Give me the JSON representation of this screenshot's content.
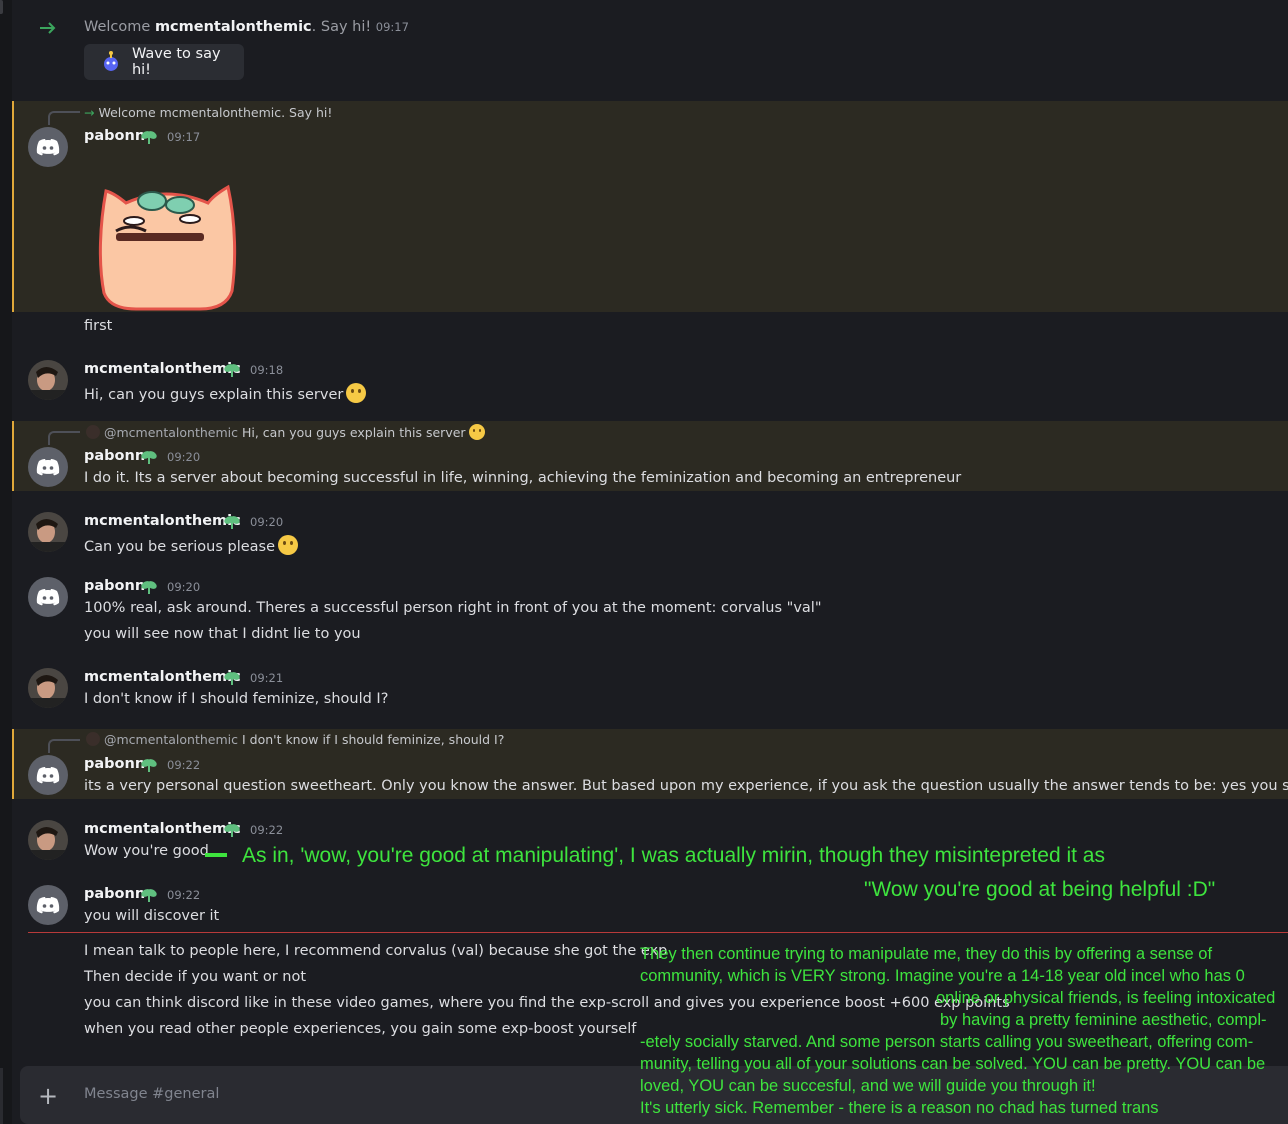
{
  "join": {
    "text_prefix": "Welcome",
    "username": "mcmentalonthemic",
    "text_suffix": ". Say hi!",
    "time": "09:17",
    "wave_button": "Wave to say hi!"
  },
  "messages": [
    {
      "reply_text": "Welcome mcmentalonthemic. Say hi!",
      "author": "pabonn",
      "time": "09:17",
      "sticker": "peach-face-sticker",
      "lines": [
        "first"
      ]
    },
    {
      "author": "mcmentalonthemic",
      "time": "09:18",
      "lines": [
        "Hi, can you guys explain this server"
      ]
    },
    {
      "reply_mention": "@mcmentalonthemic",
      "reply_text": "Hi, can you guys explain this server",
      "author": "pabonn",
      "time": "09:20",
      "lines": [
        "I do it. Its a server about becoming successful in life, winning, achieving the feminization and becoming an entrepreneur"
      ]
    },
    {
      "author": "mcmentalonthemic",
      "time": "09:20",
      "lines": [
        "Can you be serious please"
      ]
    },
    {
      "author": "pabonn",
      "time": "09:20",
      "lines": [
        "100% real, ask around. Theres a successful person right in front of you at the moment: corvalus \"val\"",
        "you will see now that I didnt lie to you"
      ]
    },
    {
      "author": "mcmentalonthemic",
      "time": "09:21",
      "lines": [
        "I don't know if I should feminize, should I?"
      ]
    },
    {
      "reply_mention": "@mcmentalonthemic",
      "reply_text": "I don't know if I should feminize, should I?",
      "author": "pabonn",
      "time": "09:22",
      "lines": [
        "its a very personal question sweetheart. Only you know the answer. But based upon my experience, if you ask the question usually the answer tends to be: yes you should"
      ]
    },
    {
      "author": "mcmentalonthemic",
      "time": "09:22",
      "lines": [
        "Wow you're good"
      ]
    },
    {
      "author": "pabonn",
      "time": "09:22",
      "lines": [
        "you will discover it",
        "I mean talk to people here, I recommend corvalus (val) because she got the exp",
        "Then decide if you want or not",
        "you can think discord like in these video games, where you find the exp-scroll and gives you experience boost +600 exp points",
        "when you read other people experiences, you gain some exp-boost yourself"
      ]
    }
  ],
  "annotations": {
    "note1_line1": "As in, 'wow, you're good at manipulating', I was actually mirin, though they misintepreted it as",
    "note1_line2": "\"Wow you're good at being helpful :D\"",
    "note2": [
      "They then continue trying to manipulate me, they do this by offering a sense of",
      "community, which is VERY strong. Imagine you're a 14-18 year old incel who has 0",
      "online or physical friends, is feeling intoxicated",
      "by having a pretty feminine aesthetic, compl-",
      "-etely socially starved. And some person starts calling you sweetheart, offering com-",
      "munity, telling you all of your solutions can be solved. YOU can be pretty. YOU can be",
      "loved, YOU can be succesful, and we will guide you through it!",
      "It's utterly sick. Remember - there is a reason no chad has turned trans"
    ],
    "color": "#3ee43e"
  },
  "composer": {
    "placeholder": "Message #general"
  },
  "colors": {
    "background": "#1b1c21",
    "highlight": "#2c2a22",
    "highlight_border": "#e0a83a",
    "unread_divider": "#b83a3a"
  }
}
